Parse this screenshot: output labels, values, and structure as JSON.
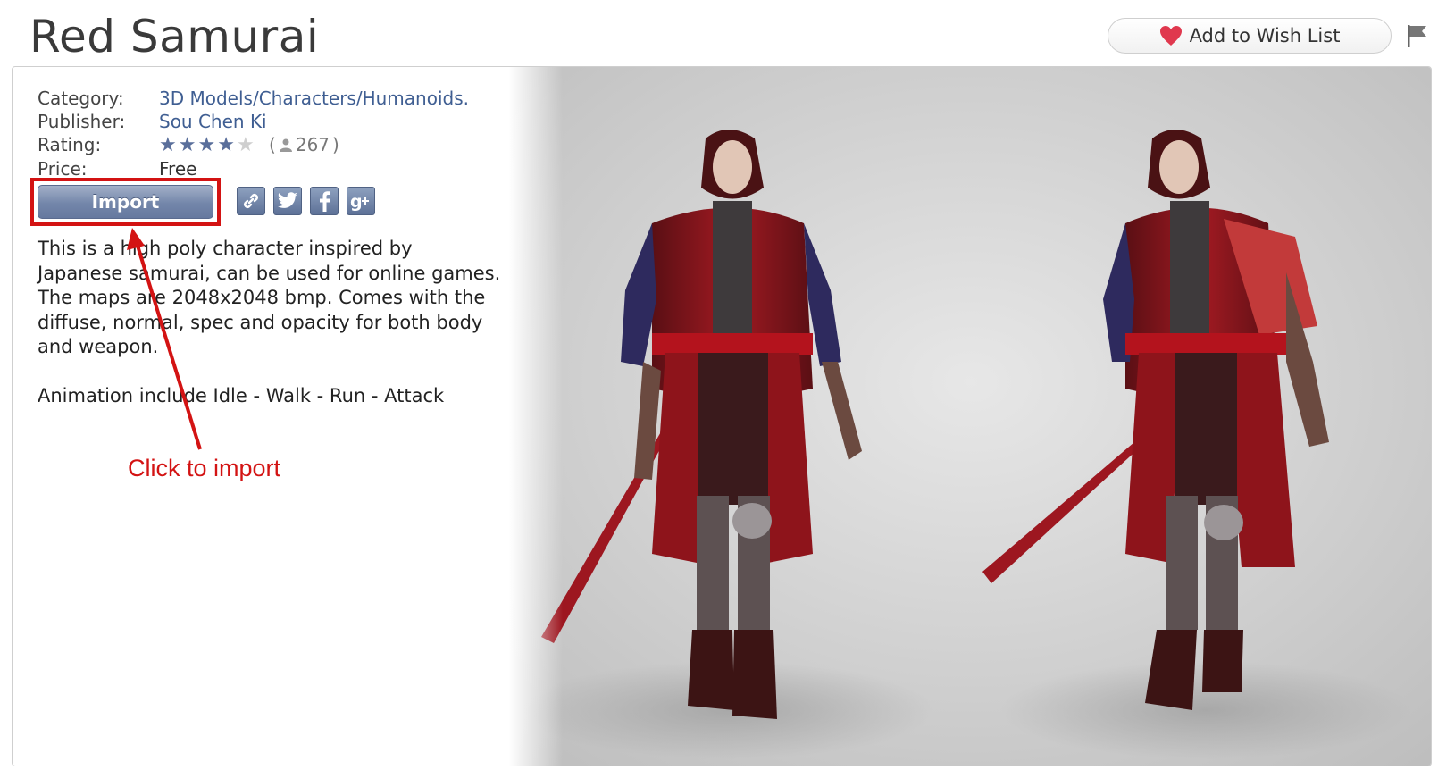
{
  "page": {
    "title": "Red Samurai",
    "wishlist_label": "Add to Wish List"
  },
  "details": {
    "category_label": "Category:",
    "category_value": "3D Models/Characters/Humanoids.",
    "publisher_label": "Publisher:",
    "publisher_value": "Sou Chen Ki",
    "rating_label": "Rating:",
    "rating_stars": 4,
    "rating_max": 5,
    "rating_count": "267",
    "rating_open": "(",
    "rating_close": ")",
    "price_label": "Price:",
    "price_value": "Free"
  },
  "actions": {
    "import_label": "Import",
    "social": [
      {
        "name": "link",
        "glyph": "🔗"
      },
      {
        "name": "twitter",
        "glyph": "t"
      },
      {
        "name": "facebook",
        "glyph": "f"
      },
      {
        "name": "google-plus",
        "glyph": "g+"
      }
    ]
  },
  "description": {
    "paragraph1": "This is a high poly character inspired by Japanese samurai, can be used for online games. The maps are 2048x2048 bmp. Comes with the diffuse, normal, spec and opacity for both body and weapon.",
    "paragraph2": "Animation include Idle - Walk - Run - Attack"
  },
  "annotation": {
    "callout": "Click to import",
    "color": "#d31313"
  },
  "colors": {
    "link": "#3f5e92",
    "button": "#7386aa",
    "highlight": "#d31313"
  }
}
